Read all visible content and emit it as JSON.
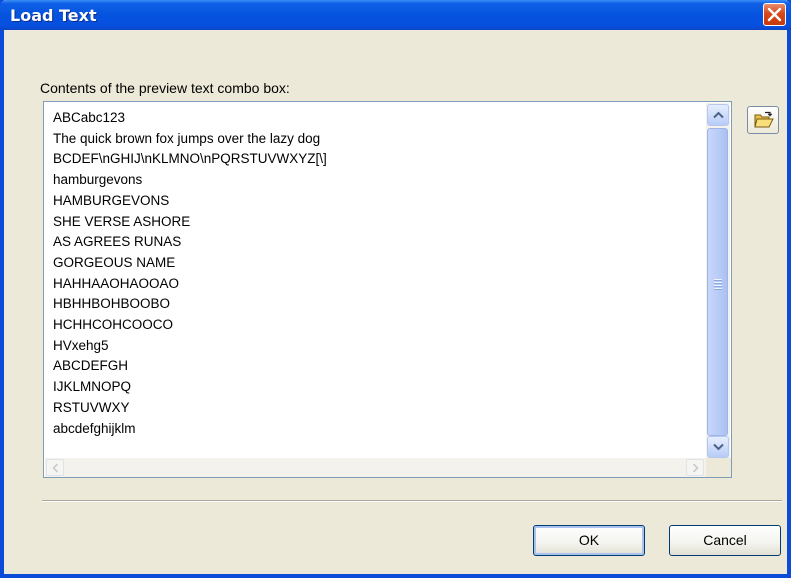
{
  "window": {
    "title": "Load Text"
  },
  "preview": {
    "label": "Contents of the preview text combo box:",
    "lines": [
      "ABCabc123",
      "The quick brown fox jumps over the lazy dog",
      "BCDEF\\nGHIJ\\nKLMNO\\nPQRSTUVWXYZ[\\]",
      "hamburgevons",
      "HAMBURGEVONS",
      "SHE VERSE ASHORE",
      "AS AGREES RUNAS",
      "GORGEOUS NAME",
      "HAHHAAOHAOOAO",
      "HBHHBOHBOOBO",
      "HCHHCOHCOOCO",
      "HVxehg5",
      "ABCDEFGH",
      "IJKLMNOPQ",
      "RSTUVWXY",
      "abcdefghijklm"
    ]
  },
  "buttons": {
    "ok": "OK",
    "cancel": "Cancel"
  },
  "icons": {
    "close": "close-icon",
    "open_folder": "open-folder-icon"
  },
  "colors": {
    "titlebar": "#0553de",
    "dialog_bg": "#ece9d8",
    "close": "#d8481b"
  }
}
